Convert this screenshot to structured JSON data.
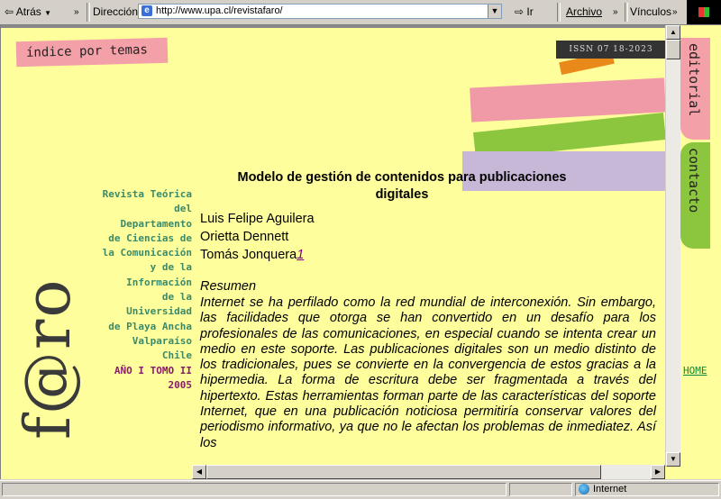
{
  "browser": {
    "back_label": "Atrás",
    "address_label": "Dirección",
    "url": "http://www.upa.cl/revistafaro/",
    "go_label": "Ir",
    "archivo_label": "Archivo",
    "vinculos_label": "Vínculos",
    "status_zone": "Internet"
  },
  "page": {
    "indice_label": "índice por temas",
    "issn": "ISSN 07 18-2023",
    "logo_text": "f@ro",
    "tab_editorial": "editorial",
    "tab_contacto": "contacto",
    "home_link": "HOME",
    "side_info": [
      "Revista Teórica",
      "del",
      "Departamento",
      "de Ciencias de",
      "la Comunicación",
      "y de la",
      "Información",
      "de la",
      "Universidad",
      "de Playa Ancha",
      "Valparaíso",
      "Chile"
    ],
    "issue": "AÑO I TOMO II",
    "year": "2005",
    "article_title": "Modelo de gestión de contenidos para publicaciones digitales",
    "authors": [
      "Luis Felipe Aguilera",
      "Orietta Dennett",
      "Tomás Jonquera"
    ],
    "footnote_ref": "1",
    "abstract_heading": "Resumen",
    "abstract_text": "Internet se ha perfilado como la red mundial de interconexión. Sin embargo, las facilidades que otorga se han convertido en un desafío para los profesionales de las comunicaciones, en especial cuando se intenta crear un medio en este soporte. Las publicaciones digitales son un medio distinto de los tradicionales, pues se convierte en la convergencia de estos gracias a la hipermedia. La forma de escritura debe ser fragmentada a través del hipertexto. Estas herramientas forman parte de las características del soporte Internet, que en una publicación noticiosa permitiría conservar valores del periodismo informativo, ya que no le afectan los problemas de inmediatez. Así los"
  },
  "colors": {
    "page_bg": "#fffe9c",
    "pink": "#f4a0a8",
    "green": "#8cc63f",
    "lilac": "#c8b8d8",
    "orange": "#e8891a",
    "side_text": "#3a8a6a",
    "issue_text": "#8a1a6a"
  }
}
